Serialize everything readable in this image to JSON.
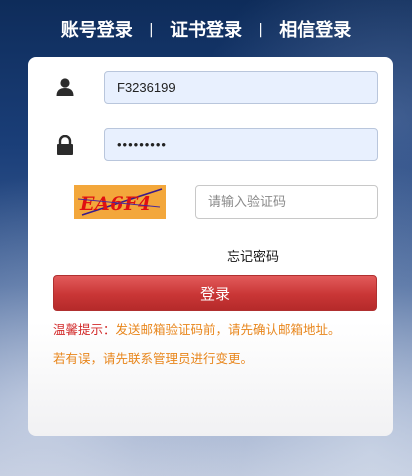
{
  "tabs": {
    "account_login": "账号登录",
    "separator": "|",
    "certificate_login": "证书登录",
    "trust_login": "相信登录"
  },
  "form": {
    "username_value": "F3236199",
    "password_value": "•••••••••",
    "captcha_text": "EA6F4",
    "captcha_placeholder": "请输入验证码",
    "forgot_password": "忘记密码",
    "login_button": "登录"
  },
  "tips": {
    "prefix": "温馨提示：",
    "line1": "发送邮箱验证码前，请先确认邮箱地址。",
    "line2": "若有误，请先联系管理员进行变更。"
  },
  "colors": {
    "login_button": "#c93636",
    "tip_prefix": "#d22a2a",
    "tip_text": "#e8861c",
    "captcha_bg": "#f3a73b",
    "captcha_text": "#e01010",
    "input_bg": "#e8f0fe"
  },
  "icons": {
    "username": "user-icon",
    "password": "lock-icon"
  }
}
